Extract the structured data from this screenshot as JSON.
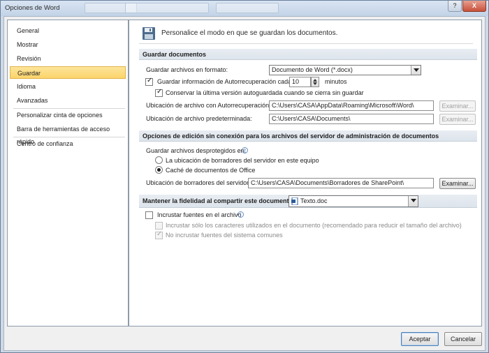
{
  "window": {
    "title": "Opciones de Word",
    "help_label": "?",
    "close_label": "X"
  },
  "nav": {
    "items": [
      {
        "label": "General"
      },
      {
        "label": "Mostrar"
      },
      {
        "label": "Revisión"
      },
      {
        "label": "Guardar"
      },
      {
        "label": "Idioma"
      },
      {
        "label": "Avanzadas"
      },
      {
        "label": "Personalizar cinta de opciones"
      },
      {
        "label": "Barra de herramientas de acceso rápido"
      },
      {
        "label": "Centro de confianza"
      }
    ],
    "selected": "Guardar"
  },
  "header": {
    "text": "Personalice el modo en que se guardan los documentos."
  },
  "save": {
    "section_title": "Guardar documentos",
    "format_label": "Guardar archivos en formato:",
    "format_value": "Documento de Word (*.docx)",
    "autorecover_label": "Guardar información de Autorrecuperación cada",
    "autorecover_checked": true,
    "autorecover_minutes": "10",
    "minutes_label": "minutos",
    "keep_last_label": "Conservar la última versión autoguardada cuando se cierra sin guardar",
    "keep_last_checked": true,
    "autorecover_path_label": "Ubicación de archivo con Autorrecuperación:",
    "autorecover_path": "C:\\Users\\CASA\\AppData\\Roaming\\Microsoft\\Word\\",
    "default_path_label": "Ubicación de archivo predeterminada:",
    "default_path": "C:\\Users\\CASA\\Documents\\",
    "browse_label": "Examinar..."
  },
  "offline": {
    "section_title": "Opciones de edición sin conexión para los archivos del servidor de administración de documentos",
    "save_checked_out_label": "Guardar archivos desprotegidos en:",
    "option_server_drafts": "La ubicación de borradores del servidor en este equipo",
    "option_office_cache": "Caché de documentos de Office",
    "selected_option": "Caché de documentos de Office",
    "drafts_location_label": "Ubicación de borradores del servidor:",
    "drafts_location": "C:\\Users\\CASA\\Documents\\Borradores de SharePoint\\",
    "browse_label": "Examinar..."
  },
  "fidelity": {
    "label": "Mantener la fidelidad al compartir este documento:",
    "document": "Texto.doc",
    "embed_fonts_label": "Incrustar fuentes en el archivo",
    "embed_fonts_checked": false,
    "embed_used_chars_label": "Incrustar sólo los caracteres utilizados en el documento (recomendado para reducir el tamaño del archivo)",
    "embed_used_chars_checked": false,
    "no_common_fonts_label": "No incrustar fuentes del sistema comunes",
    "no_common_fonts_checked": true
  },
  "footer": {
    "ok_label": "Aceptar",
    "cancel_label": "Cancelar"
  },
  "colors": {
    "nav_selected": "#fbd36a",
    "section_band": "#e3e9ef",
    "title_bar": "#c9d8ea"
  }
}
